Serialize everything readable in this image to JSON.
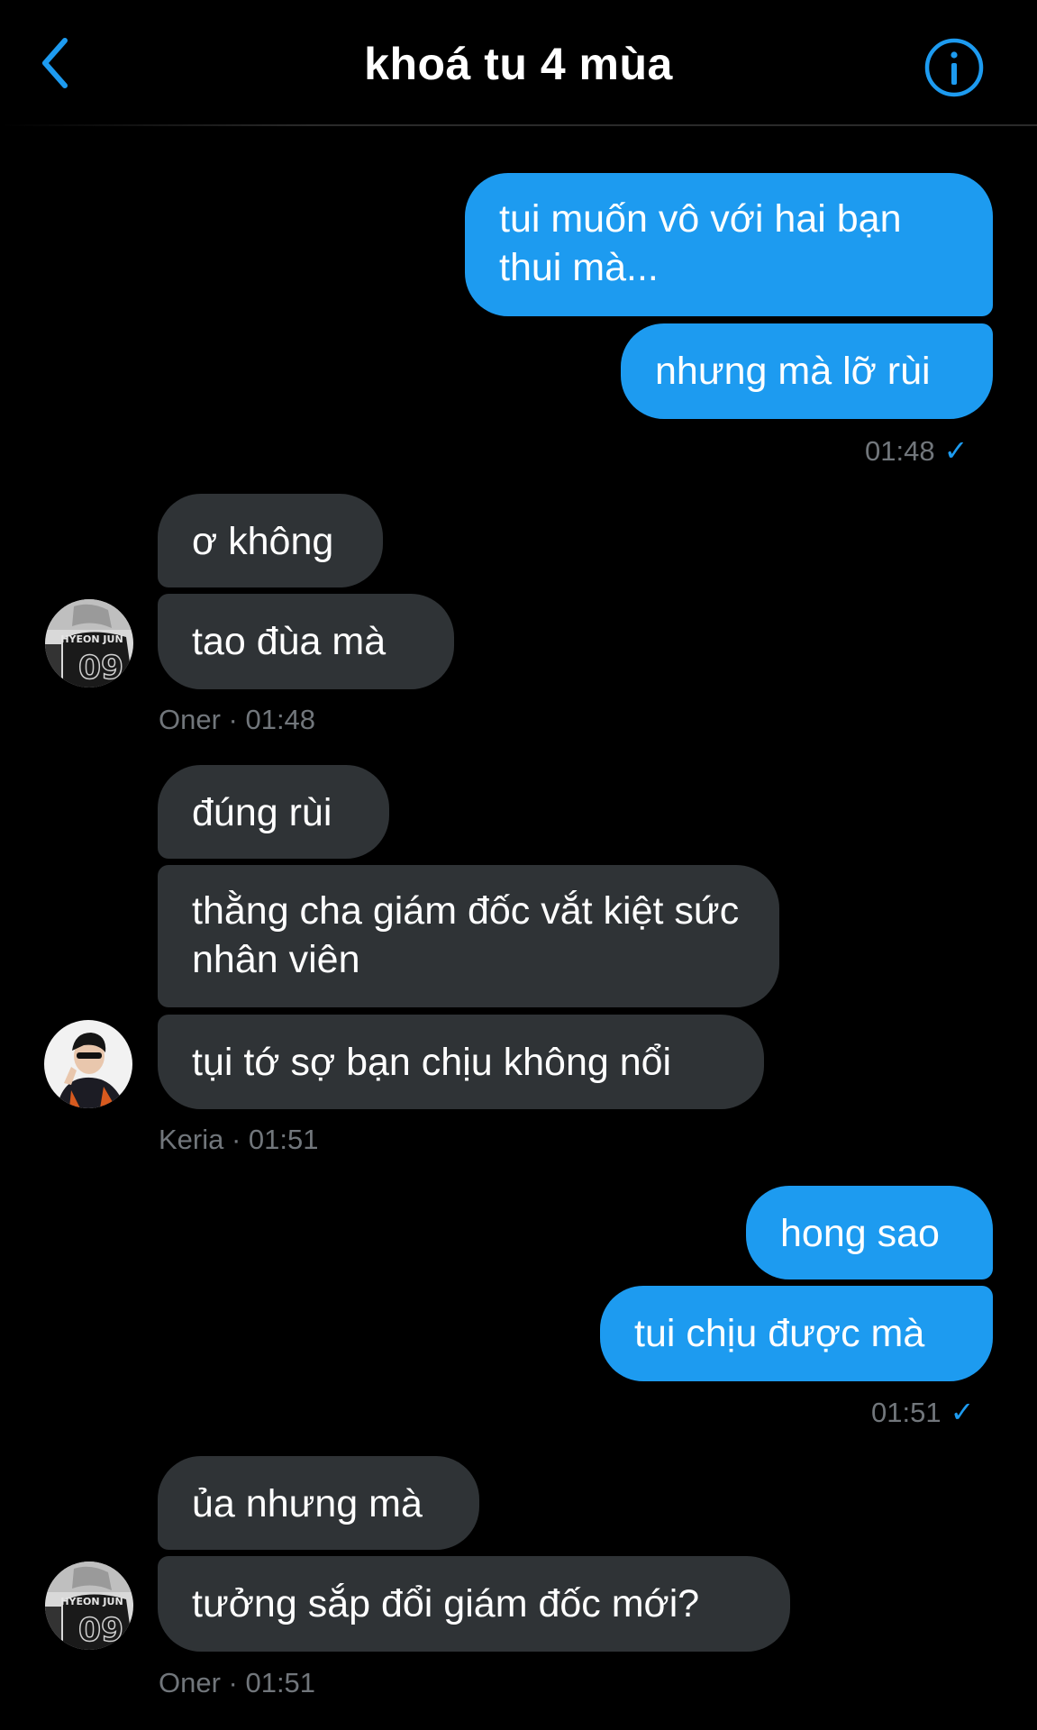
{
  "header": {
    "title": "khoá tu 4 mùa",
    "back_icon": "chevron-left-icon",
    "info_icon": "info-icon",
    "accent": "#1d9bf0"
  },
  "messages": [
    {
      "side": "out",
      "text": "tui muốn vô với hai bạn thui mà..."
    },
    {
      "side": "out",
      "text": "nhưng mà lỡ rùi"
    },
    {
      "side": "in",
      "sender": "Oner",
      "text": "ơ không"
    },
    {
      "side": "in",
      "sender": "Oner",
      "text": "tao đùa mà"
    },
    {
      "side": "in",
      "sender": "Keria",
      "text": "đúng rùi"
    },
    {
      "side": "in",
      "sender": "Keria",
      "text": "thằng cha giám đốc vắt kiệt sức nhân viên"
    },
    {
      "side": "in",
      "sender": "Keria",
      "text": "tụi tớ sợ bạn chịu không nổi"
    },
    {
      "side": "out",
      "text": "hong sao"
    },
    {
      "side": "out",
      "text": "tui chịu được mà"
    },
    {
      "side": "in",
      "sender": "Oner",
      "text": "ủa nhưng mà"
    },
    {
      "side": "in",
      "sender": "Oner",
      "text": "tưởng sắp đổi giám đốc mới?"
    }
  ],
  "meta": {
    "sent_1": "01:48",
    "oner_1": "Oner · 01:48",
    "keria_1": "Keria · 01:51",
    "sent_2": "01:51",
    "oner_2": "Oner · 01:51",
    "check_icon": "✓"
  },
  "avatars": {
    "oner_jersey_name": "HYEON JUN",
    "oner_jersey_number": "09"
  },
  "colors": {
    "outgoing_bubble": "#1d9bf0",
    "incoming_bubble": "#2f3336",
    "meta_text": "#71767b",
    "background": "#000000"
  }
}
